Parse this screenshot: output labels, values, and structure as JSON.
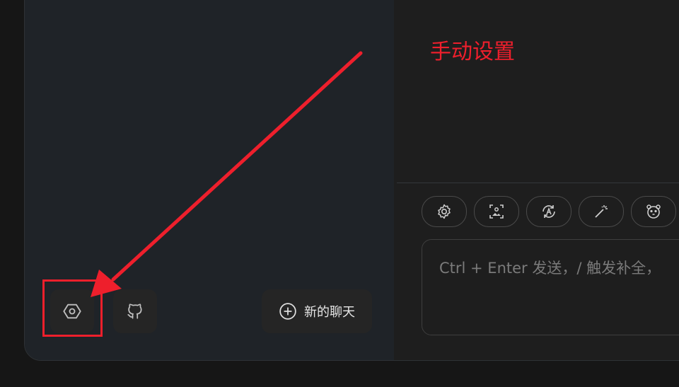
{
  "sidebar": {
    "settings_button": {
      "icon": "settings-hexagon-icon"
    },
    "github_button": {
      "icon": "github-icon"
    },
    "new_chat": {
      "label": "新的聊天",
      "icon": "plus-circle-icon"
    }
  },
  "chat_toolbar": {
    "chips": [
      {
        "icon": "gear-icon"
      },
      {
        "icon": "image-scan-icon"
      },
      {
        "icon": "auto-translate-icon"
      },
      {
        "icon": "magic-wand-icon"
      },
      {
        "icon": "mask-face-icon"
      }
    ]
  },
  "chat_input": {
    "placeholder": "Ctrl + Enter 发送，/ 触发补全，"
  },
  "annotation": {
    "text": "手动设置",
    "color": "#ee1f2c"
  }
}
